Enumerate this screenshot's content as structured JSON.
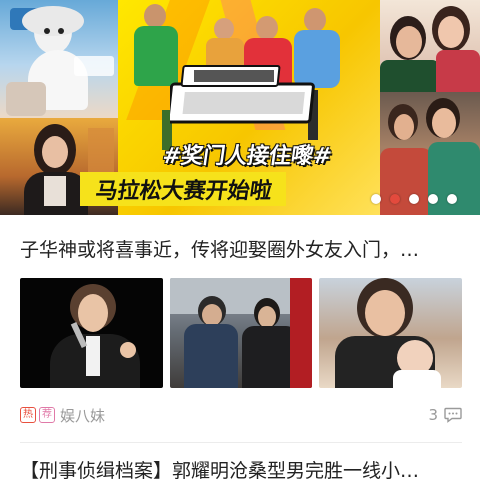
{
  "banner": {
    "hashtag": "#奖门人接住嚟#",
    "headline": "马拉松大赛开始啦",
    "logo_text": "铁甲无敌 奖门人",
    "slide_count": 5,
    "active_slide": 2
  },
  "articles": [
    {
      "title": "子华神或将喜事近，传将迎娶圈外女友入门，…",
      "thumbnails": [
        "photo-singer-microphone",
        "photo-couple-street",
        "photo-man-with-baby"
      ],
      "tags": [
        "热",
        "荐"
      ],
      "source": "娱八妹",
      "comment_count": "3"
    },
    {
      "title": "【刑事侦缉档案】郭耀明沧桑型男完胜一线小…"
    }
  ],
  "colors": {
    "banner_yellow": "#f6e21b",
    "dot_active": "#e34a3d",
    "tag_hot": "#e8503f",
    "tag_recommend": "#e07aa8",
    "meta_gray": "#9a9a9a"
  }
}
